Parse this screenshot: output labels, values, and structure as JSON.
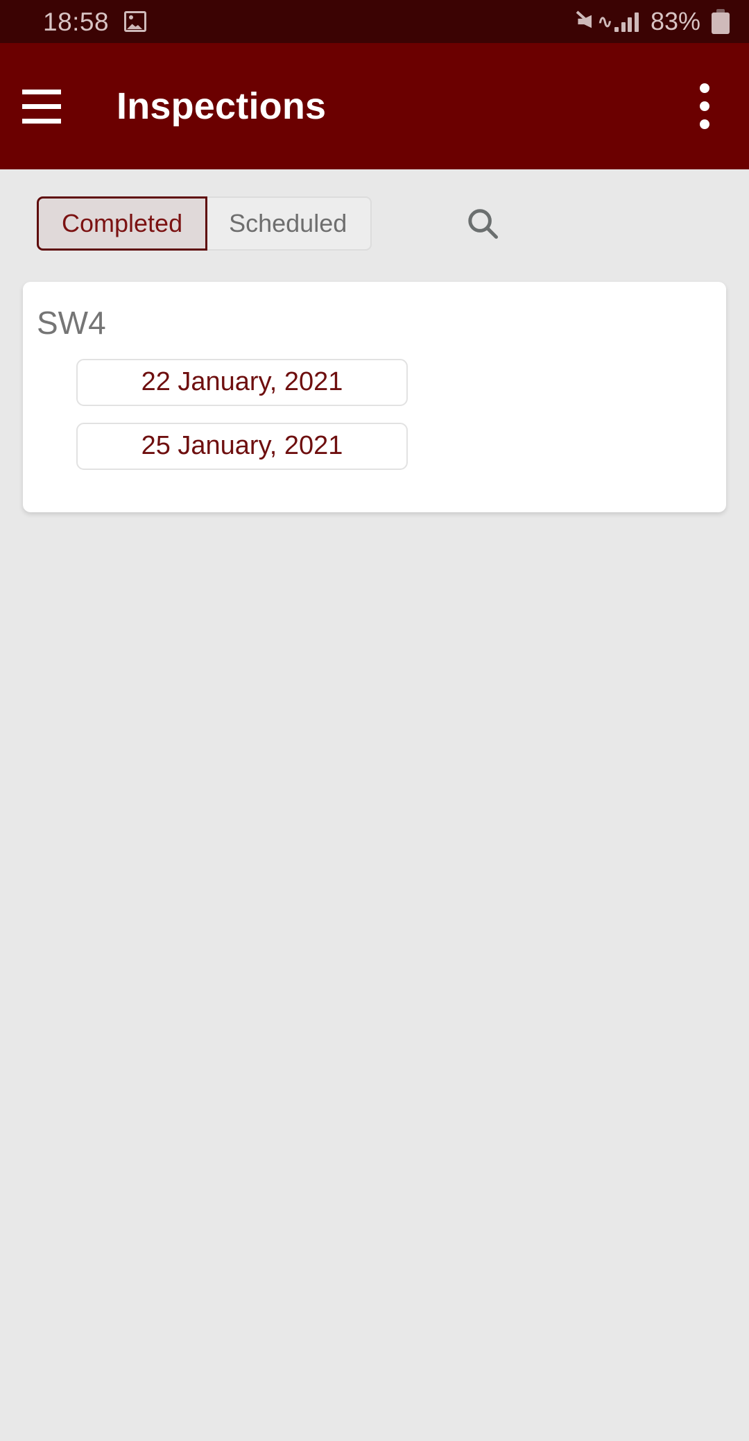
{
  "status_bar": {
    "time": "18:58",
    "photo_icon": "photo-icon",
    "mute_icon": "volume-mute-vibrate-icon",
    "signal_icon": "cellular-signal-icon",
    "battery_percent": "83%",
    "battery_icon": "battery-icon"
  },
  "app_bar": {
    "menu_icon": "hamburger-menu-icon",
    "title": "Inspections",
    "overflow_icon": "more-vertical-icon"
  },
  "filters": {
    "tabs": [
      {
        "label": "Completed",
        "selected": true
      },
      {
        "label": "Scheduled",
        "selected": false
      }
    ],
    "search_icon": "search-icon"
  },
  "inspections": [
    {
      "site": "SW4",
      "dates": [
        "22 January, 2021",
        "25 January, 2021"
      ]
    }
  ],
  "colors": {
    "status_bar": "#3b0303",
    "app_bar": "#6b0000",
    "page_background": "#e8e8e8",
    "accent": "#6e0f0f",
    "selected_tab_border": "#5e0b0b",
    "selected_tab_fill": "#e0d9d9",
    "card_background": "#ffffff"
  }
}
